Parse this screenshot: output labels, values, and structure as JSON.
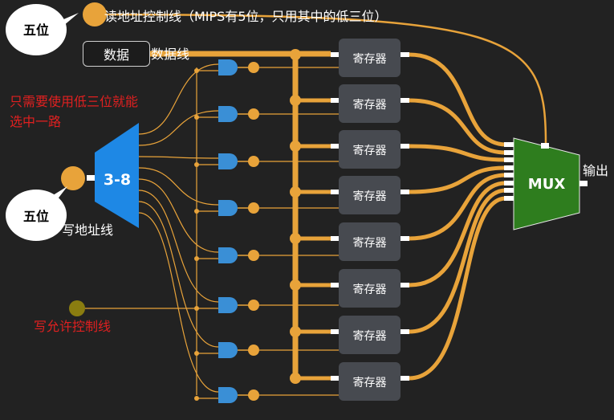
{
  "labels": {
    "read_addr_line": "读地址控制线（MIPS有5位，只用其中的低三位）",
    "data_button": "数据",
    "data_line": "数据线",
    "low3_note_line1": "只需要使用低三位就能",
    "low3_note_line2": "选中一路",
    "decoder": "3-8",
    "write_addr_line": "写地址线",
    "write_enable_line": "写允许控制线",
    "mux": "MUX",
    "output": "输出"
  },
  "bubbles": {
    "read_bits": "五位",
    "write_bits": "五位"
  },
  "registers": [
    "寄存器",
    "寄存器",
    "寄存器",
    "寄存器",
    "寄存器",
    "寄存器",
    "寄存器",
    "寄存器"
  ],
  "colors": {
    "background": "#222222",
    "wire": "#e8a33a",
    "decoder": "#1e88e5",
    "mux": "#2e7d1e",
    "and_gate": "#3a8fd6",
    "register": "#474a50",
    "note_red": "#e02020",
    "enable_dot": "#8a7d10"
  }
}
